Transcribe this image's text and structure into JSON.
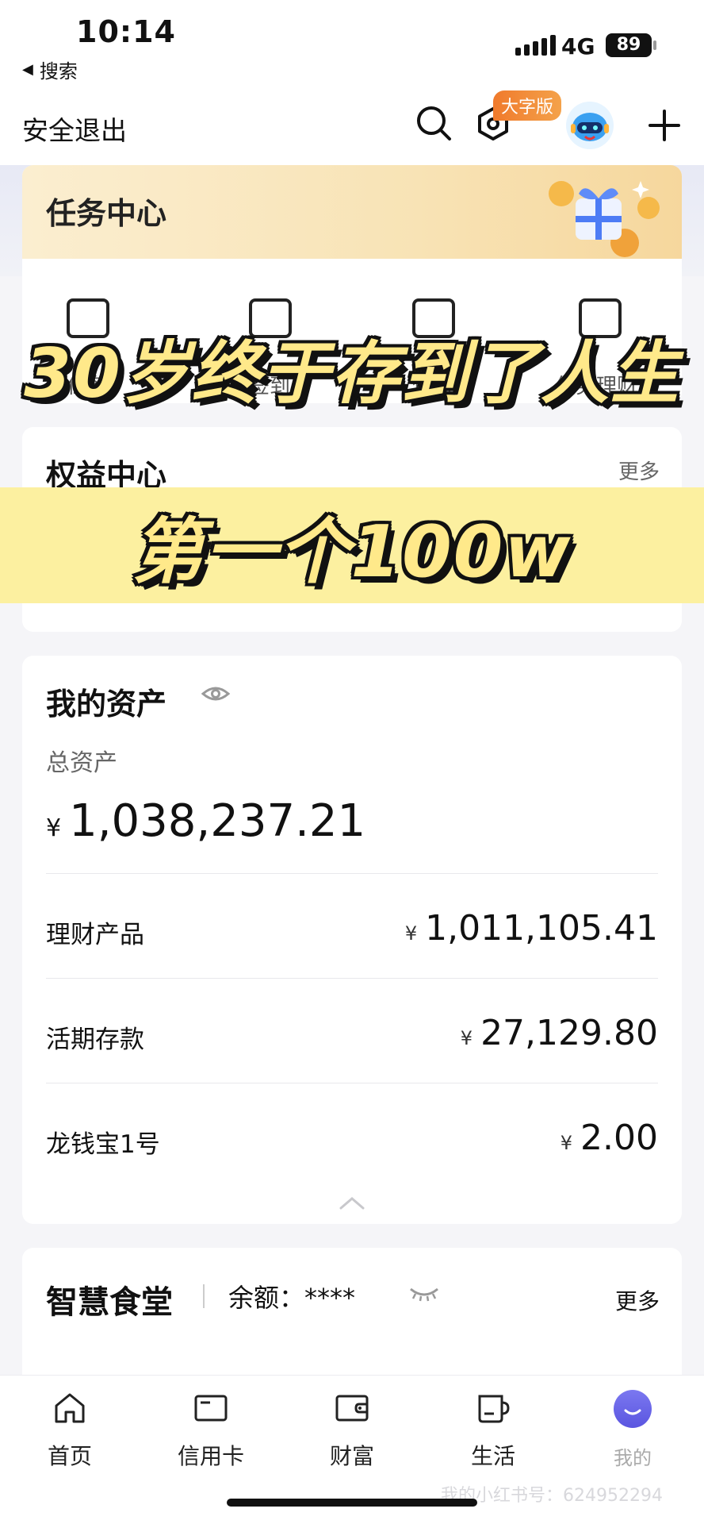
{
  "status_bar": {
    "time": "10:14",
    "back_app": "搜索",
    "network": "4G",
    "battery": "89"
  },
  "header": {
    "logout": "安全退出",
    "big_font_badge": "大字版",
    "icons": [
      "search-icon",
      "settings-hexagon-icon",
      "avatar-robot",
      "plus-icon"
    ]
  },
  "task_center": {
    "title": "任务中心",
    "items": [
      "任务",
      "签到",
      "任务",
      "任务理财"
    ]
  },
  "rights_center": {
    "title": "权益中心",
    "more": "更多"
  },
  "overlay": {
    "line1": "30岁终于存到了人生",
    "line2": "第一个100w"
  },
  "assets": {
    "title": "我的资产",
    "total_label": "总资产",
    "currency": "¥",
    "total_value": "1,038,237.21",
    "rows": [
      {
        "name": "理财产品",
        "amount": "1,011,105.41"
      },
      {
        "name": "活期存款",
        "amount": "27,129.80"
      },
      {
        "name": "龙钱宝1号",
        "amount": "2.00"
      }
    ]
  },
  "canteen": {
    "title": "智慧食堂",
    "balance": "余额：****",
    "more": "更多"
  },
  "tabbar": {
    "tabs": [
      "首页",
      "信用卡",
      "财富",
      "生活",
      "我的"
    ]
  },
  "watermark": "我的小红书号：624952294",
  "colors": {
    "accent_orange": "#f07a2c",
    "caption_yellow": "#ffe98a",
    "mine_purple": "#5a55e0"
  }
}
